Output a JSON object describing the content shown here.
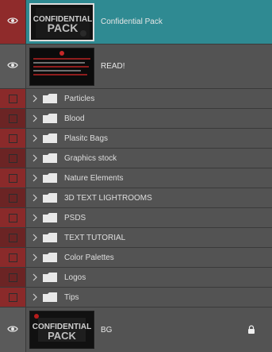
{
  "layers": {
    "top": [
      {
        "name": "Confidential Pack",
        "thumb_text": "CONFIDENTIAL PACK",
        "selected": true,
        "visible": true
      },
      {
        "name": "READ!",
        "visible": true
      }
    ],
    "folders": [
      {
        "name": "Particles"
      },
      {
        "name": "Blood"
      },
      {
        "name": "Plasitc Bags"
      },
      {
        "name": "Graphics stock"
      },
      {
        "name": "Nature Elements"
      },
      {
        "name": "3D TEXT LIGHTROOMS"
      },
      {
        "name": "PSDS"
      },
      {
        "name": "TEXT TUTORIAL"
      },
      {
        "name": "Color Palettes"
      },
      {
        "name": "Logos"
      },
      {
        "name": "Tips"
      }
    ],
    "bottom": {
      "name": "BG",
      "thumb_text": "CONFIDENTIAL PACK",
      "locked": true
    }
  },
  "colors": {
    "panel_bg": "#535353",
    "selected_bg": "#2f8a92",
    "visibility_red": "#8a2a2a",
    "text": "#e6e6e6"
  },
  "icons": {
    "visibility": "eye-icon",
    "chevron": "chevron-right-icon",
    "folder": "folder-icon",
    "lock": "lock-icon"
  }
}
